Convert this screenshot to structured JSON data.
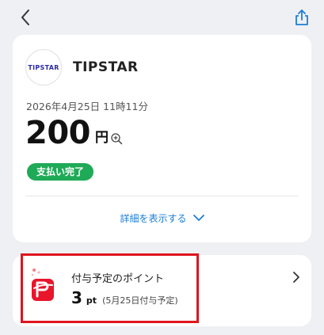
{
  "header": {
    "back_icon": "chevron-left-icon",
    "share_icon": "share-icon"
  },
  "merchant": {
    "logo_text": "TIPSTAR",
    "name": "TIPSTAR",
    "datetime": "2026年4月25日 11時11分",
    "amount": "200",
    "currency": "円",
    "zoom_icon": "zoom-in-icon",
    "status": "支払い完了",
    "status_color": "#1faa57",
    "details_label": "詳細を表示する"
  },
  "points": {
    "icon": "paypay-icon",
    "label": "付与予定のポイント",
    "value": "3",
    "unit": "pt",
    "note": "(5月25日付与予定)"
  },
  "colors": {
    "accent_blue": "#1d7ed8",
    "highlight_red": "#e0141e",
    "background": "#eef0f3"
  }
}
